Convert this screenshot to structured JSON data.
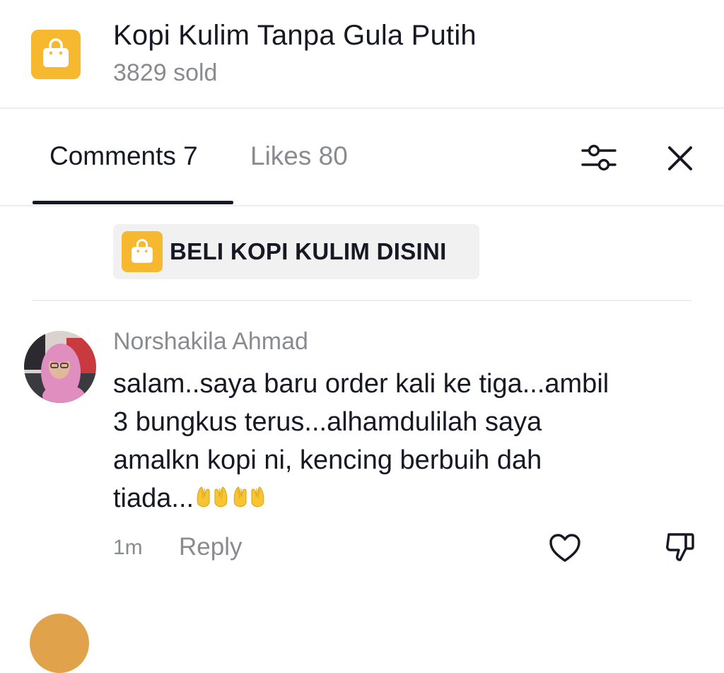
{
  "product": {
    "icon": "shopping-bag-icon",
    "title": "Kopi Kulim Tanpa Gula Putih",
    "sold": "3829 sold",
    "accent_color": "#F5B82E"
  },
  "tabs": [
    {
      "label": "Comments 7",
      "active": true
    },
    {
      "label": "Likes 80",
      "active": false
    }
  ],
  "toolbar": {
    "filter_icon": "filter-sliders-icon",
    "close_icon": "close-icon"
  },
  "shop_link": {
    "icon": "shopping-bag-icon",
    "label": "BELI KOPI KULIM DISINI"
  },
  "comment": {
    "author": "Norshakila Ahmad",
    "text": "salam..saya baru order kali ke tiga...ambil\n3 bungkus terus...alhamdulilah saya\namalkn kopi ni, kencing berbuih dah\ntiada...",
    "emoji": [
      "palms-up-together-emoji",
      "palms-up-together-emoji"
    ],
    "time": "1m",
    "reply_label": "Reply",
    "like_icon": "heart-outline-icon",
    "dislike_icon": "thumbs-down-icon"
  },
  "colors": {
    "primary_text": "#161823",
    "secondary_text": "#8A8B91",
    "divider": "#EDEDEE",
    "chip_background": "#F1F1F2"
  }
}
